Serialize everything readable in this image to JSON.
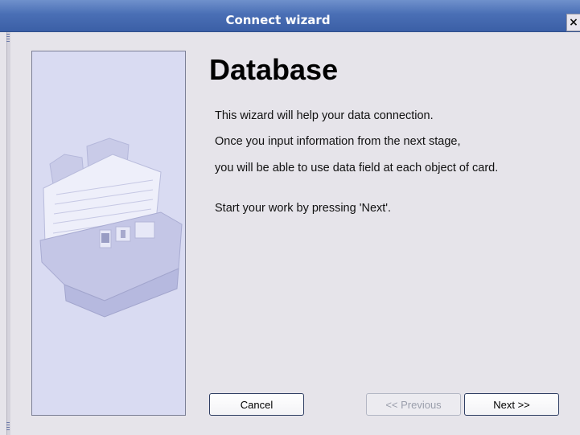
{
  "window": {
    "title": "Connect wizard",
    "close_glyph": "×"
  },
  "wizard": {
    "heading": "Database",
    "lines": [
      "This wizard will help your data connection.",
      "Once you input information from the next stage,",
      "you will be able to use data field at each object of card.",
      "Start your work by pressing 'Next'."
    ]
  },
  "buttons": {
    "cancel": "Cancel",
    "previous": "<< Previous",
    "next": "Next >>"
  },
  "icons": {
    "side_illustration": "card-index-box-icon",
    "close": "close-icon"
  },
  "colors": {
    "titlebar": "#4a6fb5",
    "panel": "#d9dbf2",
    "background": "#e6e4ea"
  }
}
